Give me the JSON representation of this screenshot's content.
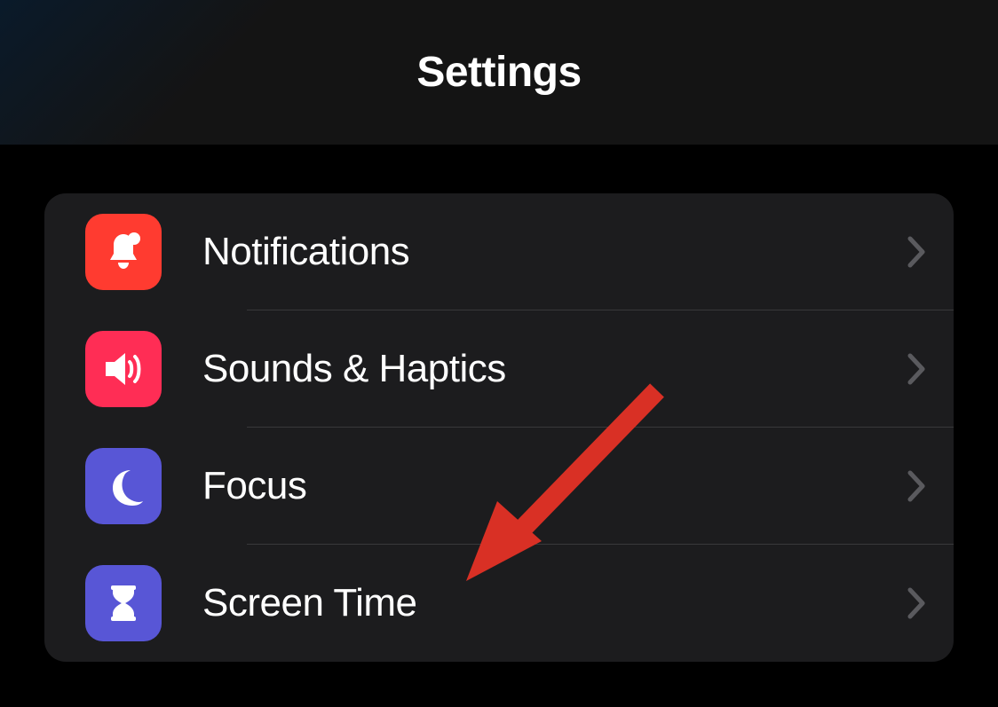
{
  "header": {
    "title": "Settings"
  },
  "settings": {
    "items": [
      {
        "label": "Notifications",
        "icon": "bell",
        "color": "#ff3b30"
      },
      {
        "label": "Sounds & Haptics",
        "icon": "speaker",
        "color": "#ff2d55"
      },
      {
        "label": "Focus",
        "icon": "moon",
        "color": "#5856d6"
      },
      {
        "label": "Screen Time",
        "icon": "hourglass",
        "color": "#5856d6"
      }
    ]
  },
  "annotation": {
    "arrow_target": "Screen Time",
    "arrow_color": "#d93025"
  }
}
